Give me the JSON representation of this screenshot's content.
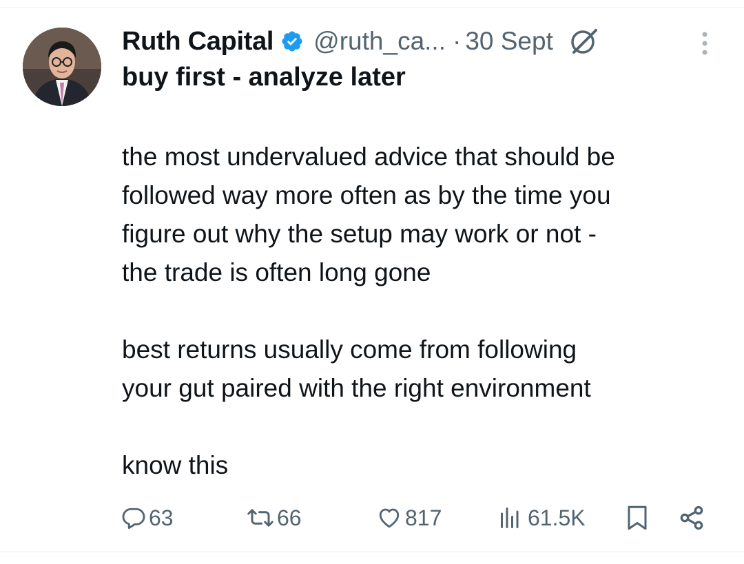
{
  "tweet": {
    "author_name": "Ruth Capital",
    "handle": "@ruth_ca...",
    "separator": "·",
    "date": "30 Sept",
    "headline": "buy first - analyze later",
    "paragraphs": [
      [
        "the most undervalued advice that should be",
        "followed way more often as by the time you",
        "figure out why the setup may work or not -",
        "the trade is often long gone"
      ],
      [
        "best returns usually come from following",
        "your gut paired with the right environment"
      ],
      [
        "know this"
      ]
    ]
  },
  "actions": {
    "replies": "63",
    "reposts": "66",
    "likes": "817",
    "views": "61.5K"
  },
  "colors": {
    "text": "#0f1419",
    "muted": "#536471",
    "verified_blue": "#1d9bf0"
  },
  "icons": [
    "verified-badge-icon",
    "grok-icon",
    "more-options-icon",
    "reply-icon",
    "repost-icon",
    "like-icon",
    "views-icon",
    "bookmark-icon",
    "share-icon"
  ]
}
